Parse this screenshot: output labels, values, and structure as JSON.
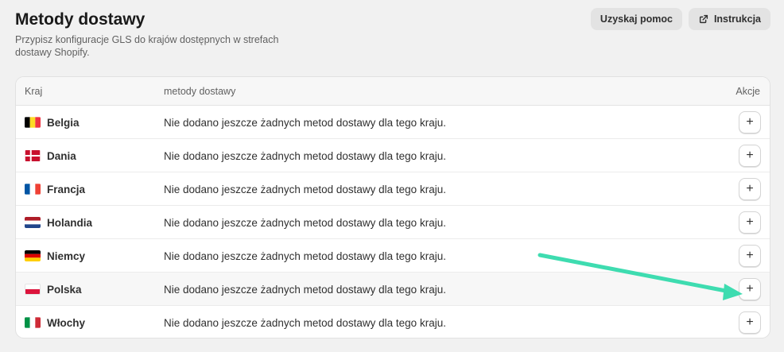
{
  "header": {
    "title": "Metody dostawy",
    "subtitle": "Przypisz konfiguracje GLS do krajów dostępnych w strefach dostawy Shopify.",
    "help_label": "Uzyskaj pomoc",
    "instructions_label": "Instrukcja"
  },
  "table": {
    "col_country": "Kraj",
    "col_methods": "metody dostawy",
    "col_actions": "Akcje",
    "empty_text": "Nie dodano jeszcze żadnych metod dostawy dla tego kraju.",
    "rows": [
      {
        "country": "Belgia",
        "flag": "belgium-flag"
      },
      {
        "country": "Dania",
        "flag": "denmark-flag"
      },
      {
        "country": "Francja",
        "flag": "france-flag"
      },
      {
        "country": "Holandia",
        "flag": "netherlands-flag"
      },
      {
        "country": "Niemcy",
        "flag": "germany-flag"
      },
      {
        "country": "Polska",
        "flag": "poland-flag"
      },
      {
        "country": "Włochy",
        "flag": "italy-flag"
      }
    ],
    "add_symbol": "+"
  },
  "colors": {
    "annotation_arrow": "#3edcb0",
    "background": "#f1f1f1"
  }
}
